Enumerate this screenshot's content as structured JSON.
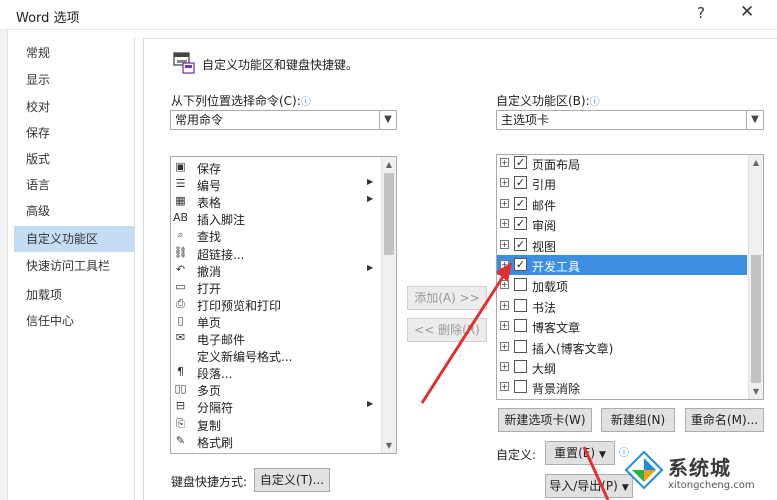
{
  "window": {
    "title": "Word 选项",
    "help_glyph": "?",
    "close_glyph": "✕"
  },
  "sidebar": {
    "items": [
      {
        "label": "常规",
        "active": false
      },
      {
        "label": "显示",
        "active": false
      },
      {
        "label": "校对",
        "active": false
      },
      {
        "label": "保存",
        "active": false
      },
      {
        "label": "版式",
        "active": false
      },
      {
        "label": "语言",
        "active": false
      },
      {
        "label": "高级",
        "active": false
      },
      {
        "label": "自定义功能区",
        "active": true
      },
      {
        "label": "快速访问工具栏",
        "active": false
      },
      {
        "label": "加载项",
        "active": false
      },
      {
        "label": "信任中心",
        "active": false
      }
    ]
  },
  "header": {
    "text": "自定义功能区和键盘快捷键。",
    "icon": "customize-ribbon-icon"
  },
  "left_panel": {
    "label": "从下列位置选择命令(C):",
    "info_glyph": "ⓘ",
    "dropdown_value": "常用命令",
    "commands": [
      {
        "icon": "save-icon",
        "glyph": "▣",
        "label": "保存",
        "submenu": false
      },
      {
        "icon": "numbering-icon",
        "glyph": "☰",
        "label": "编号",
        "submenu": true
      },
      {
        "icon": "table-icon",
        "glyph": "▦",
        "label": "表格",
        "submenu": true
      },
      {
        "icon": "footnote-icon",
        "glyph": "AB",
        "label": "插入脚注",
        "submenu": false
      },
      {
        "icon": "find-icon",
        "glyph": "⌕",
        "label": "查找",
        "submenu": false
      },
      {
        "icon": "hyperlink-icon",
        "glyph": "⛓",
        "label": "超链接...",
        "submenu": false
      },
      {
        "icon": "undo-icon",
        "glyph": "↶",
        "label": "撤消",
        "submenu": true
      },
      {
        "icon": "open-folder-icon",
        "glyph": "▭",
        "label": "打开",
        "submenu": false
      },
      {
        "icon": "print-preview-icon",
        "glyph": "⎙",
        "label": "打印预览和打印",
        "submenu": false
      },
      {
        "icon": "single-page-icon",
        "glyph": "▯",
        "label": "单页",
        "submenu": false
      },
      {
        "icon": "email-icon",
        "glyph": "✉",
        "label": "电子邮件",
        "submenu": false
      },
      {
        "icon": "blank-icon",
        "glyph": "",
        "label": "定义新编号格式...",
        "submenu": false
      },
      {
        "icon": "paragraph-icon",
        "glyph": "¶",
        "label": "段落...",
        "submenu": false
      },
      {
        "icon": "multi-page-icon",
        "glyph": "▯▯",
        "label": "多页",
        "submenu": false
      },
      {
        "icon": "page-break-icon",
        "glyph": "⊟",
        "label": "分隔符",
        "submenu": true
      },
      {
        "icon": "copy-icon",
        "glyph": "⎘",
        "label": "复制",
        "submenu": false
      },
      {
        "icon": "format-painter-icon",
        "glyph": "✎",
        "label": "格式刷",
        "submenu": false
      }
    ]
  },
  "middle_buttons": {
    "add": "添加(A) >>",
    "remove": "<< 删除(R)"
  },
  "right_panel": {
    "label": "自定义功能区(B):",
    "info_glyph": "ⓘ",
    "dropdown_value": "主选项卡",
    "tree": [
      {
        "label": "页面布局",
        "checked": true,
        "selected": false
      },
      {
        "label": "引用",
        "checked": true,
        "selected": false
      },
      {
        "label": "邮件",
        "checked": true,
        "selected": false
      },
      {
        "label": "审阅",
        "checked": true,
        "selected": false
      },
      {
        "label": "视图",
        "checked": true,
        "selected": false
      },
      {
        "label": "开发工具",
        "checked": true,
        "selected": true
      },
      {
        "label": "加载项",
        "checked": false,
        "selected": false
      },
      {
        "label": "书法",
        "checked": false,
        "selected": false
      },
      {
        "label": "博客文章",
        "checked": false,
        "selected": false
      },
      {
        "label": "插入(博客文章)",
        "checked": false,
        "selected": false
      },
      {
        "label": "大纲",
        "checked": false,
        "selected": false
      },
      {
        "label": "背景消除",
        "checked": false,
        "selected": false
      }
    ],
    "buttons": {
      "new_tab": "新建选项卡(W)",
      "new_group": "新建组(N)",
      "rename": "重命名(M)..."
    },
    "customize_label": "自定义:",
    "reset_button": "重置(E)",
    "import_export_button": "导入/导出(P)"
  },
  "keyboard": {
    "label": "键盘快捷方式:",
    "button": "自定义(T)..."
  },
  "watermark": {
    "name": "系统城",
    "url": "xitongcheng.com"
  },
  "colors": {
    "accent": "#3c8fe0",
    "sidebar_active": "#c5dcf5",
    "annotation": "#e03030"
  }
}
